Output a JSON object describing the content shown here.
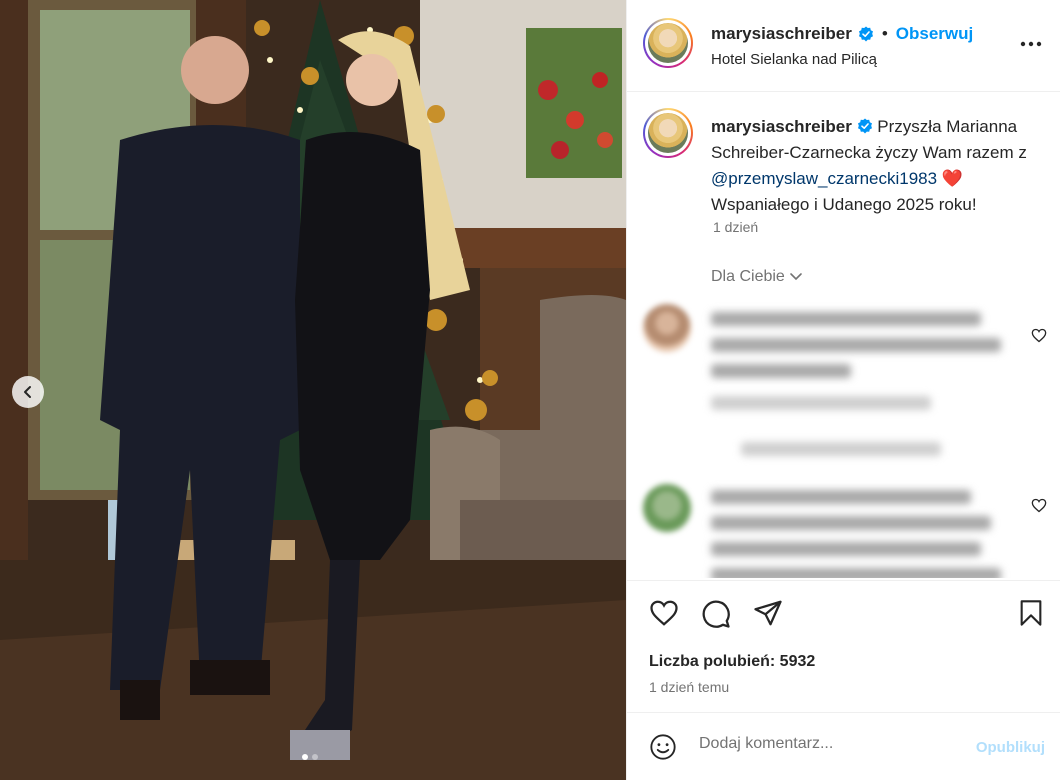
{
  "post": {
    "username": "marysiaschreiber",
    "separator": "•",
    "follow_label": "Obserwuj",
    "location": "Hotel Sielanka nad Pilicą",
    "more_icon": "more-options-icon"
  },
  "caption": {
    "username": "marysiaschreiber",
    "text_part1": "Przyszła Marianna Schreiber-Czarnecka życzy Wam razem z ",
    "mention": "@przemyslaw_czarnecki1983",
    "emoji": "❤️",
    "text_part2": "Wspaniałego i Udanego 2025 roku!",
    "time": "1 dzień"
  },
  "comments": {
    "sort_label": "Dla Ciebie"
  },
  "actions": {
    "likes_label": "Liczba polubień: 5932",
    "date": "1 dzień temu"
  },
  "comment_box": {
    "placeholder": "Dodaj komentarz...",
    "publish_label": "Opublikuj"
  },
  "colors": {
    "accent": "#0095f6",
    "verified": "#0095f6",
    "publish_disabled": "#b2dffc"
  }
}
